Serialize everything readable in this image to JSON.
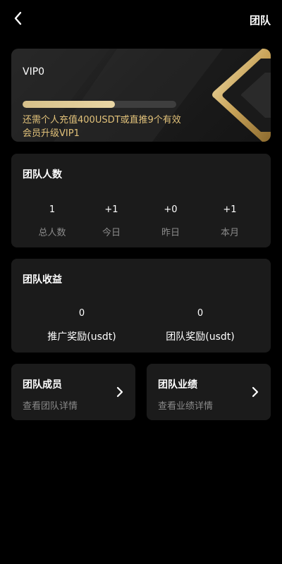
{
  "header": {
    "title": "团队"
  },
  "vip": {
    "level": "VIP0",
    "progress": 0.6,
    "hint": "还需个人充值400USDT或直推9个有效会员升级VIP1"
  },
  "team_count": {
    "title": "团队人数",
    "stats": [
      {
        "value": "1",
        "label": "总人数"
      },
      {
        "value": "+1",
        "label": "今日"
      },
      {
        "value": "+0",
        "label": "昨日"
      },
      {
        "value": "+1",
        "label": "本月"
      }
    ]
  },
  "team_income": {
    "title": "团队收益",
    "items": [
      {
        "value": "0",
        "label": "推广奖励(usdt)"
      },
      {
        "value": "0",
        "label": "团队奖励(usdt)"
      }
    ]
  },
  "nav_cards": [
    {
      "title": "团队成员",
      "subtitle": "查看团队详情"
    },
    {
      "title": "团队业绩",
      "subtitle": "查看业绩详情"
    }
  ],
  "colors": {
    "background": "#000000",
    "card": "#1b1b1b",
    "gold": "#e2c27a",
    "muted": "#8a8a8a"
  }
}
